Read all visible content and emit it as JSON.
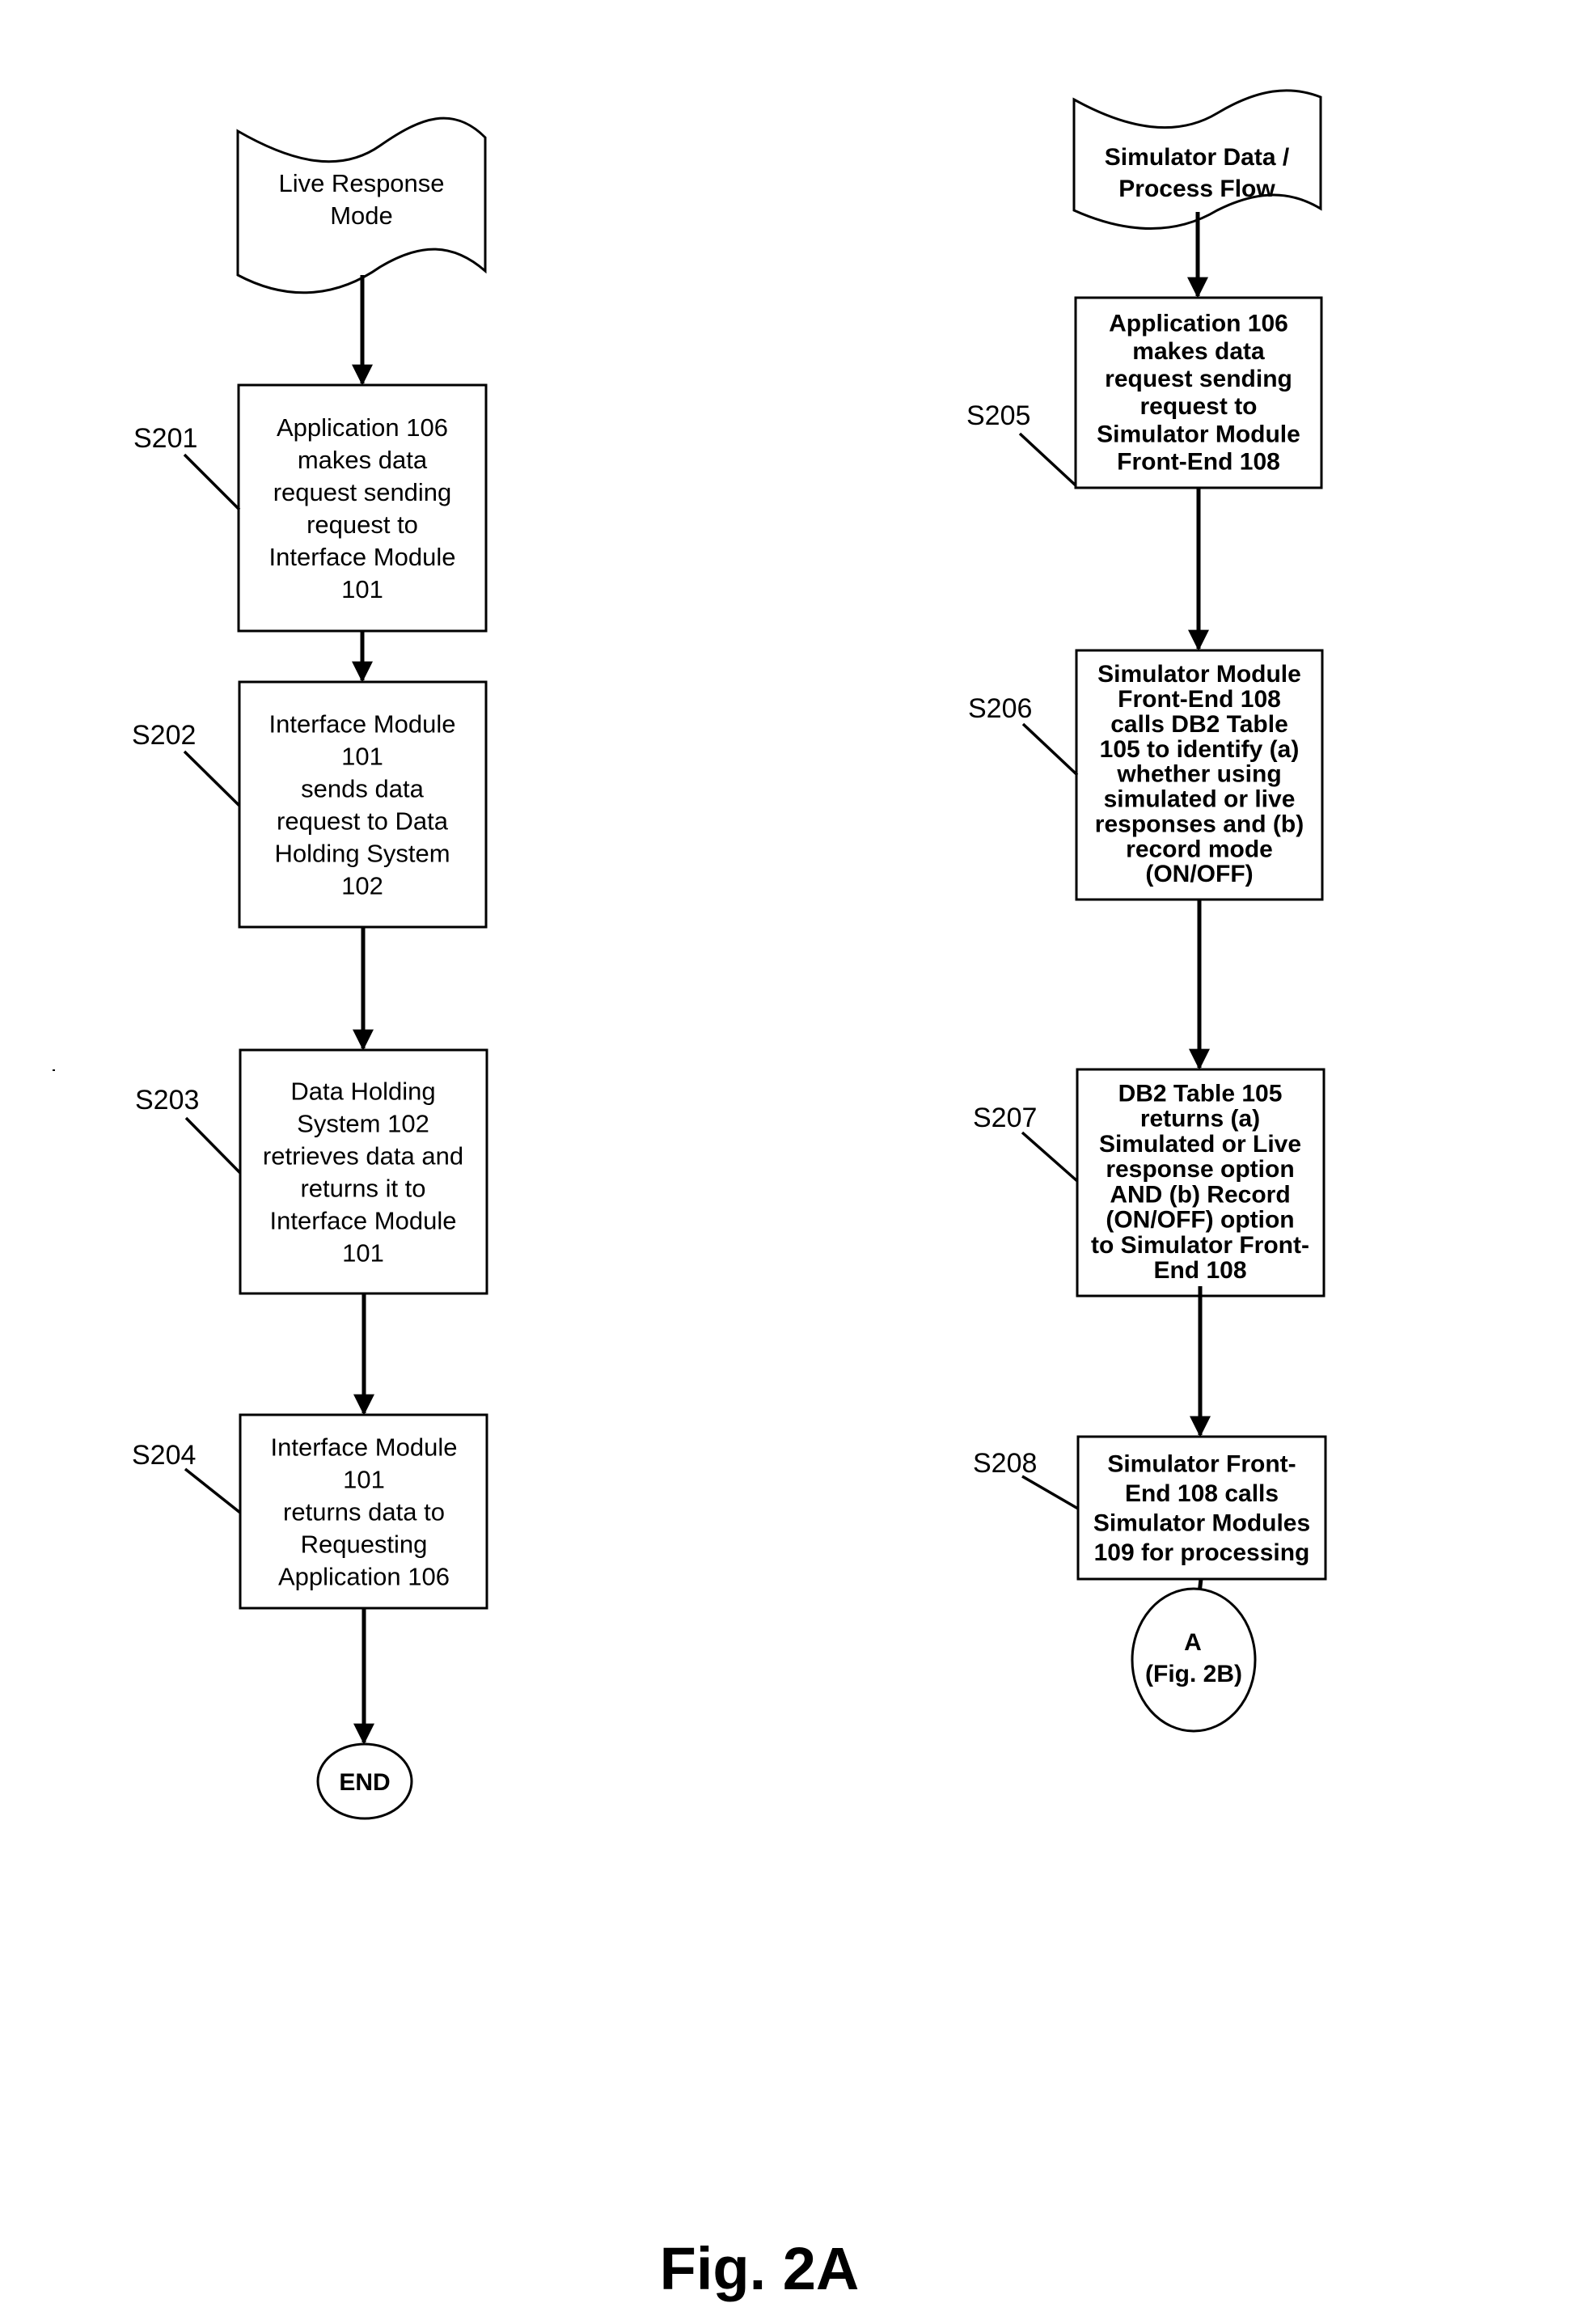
{
  "figure": {
    "caption": "Fig. 2A",
    "left_flow": {
      "start": {
        "lines": [
          "Live Response",
          "Mode"
        ],
        "shape": "document"
      },
      "steps": [
        {
          "id": "S201",
          "lines": [
            "Application 106",
            "makes data",
            "request sending",
            "request to",
            "Interface Module",
            "101"
          ]
        },
        {
          "id": "S202",
          "lines": [
            "Interface Module",
            "101",
            "sends data",
            "request to Data",
            "Holding System",
            "102"
          ]
        },
        {
          "id": "S203",
          "lines": [
            "Data Holding",
            "System 102",
            "retrieves data and",
            "returns it to",
            "Interface Module",
            "101"
          ]
        },
        {
          "id": "S204",
          "lines": [
            "Interface Module",
            "101",
            "returns data to",
            "Requesting",
            "Application 106"
          ]
        }
      ],
      "end": {
        "lines": [
          "END"
        ],
        "shape": "terminator"
      }
    },
    "right_flow": {
      "start": {
        "lines": [
          "Simulator Data /",
          "Process Flow"
        ],
        "shape": "document"
      },
      "steps": [
        {
          "id": "S205",
          "lines": [
            "Application 106",
            "makes data",
            "request sending",
            "request to",
            "Simulator Module",
            "Front-End 108"
          ]
        },
        {
          "id": "S206",
          "lines": [
            "Simulator Module",
            "Front-End 108",
            "calls DB2 Table",
            "105 to identify (a)",
            "whether using",
            "simulated or live",
            "responses and (b)",
            "record mode",
            "(ON/OFF)"
          ]
        },
        {
          "id": "S207",
          "lines": [
            "DB2 Table 105",
            "returns (a)",
            "Simulated or Live",
            "response option",
            "AND (b) Record",
            "(ON/OFF) option",
            "to Simulator Front-",
            "End 108"
          ]
        },
        {
          "id": "S208",
          "lines": [
            "Simulator Front-",
            "End 108 calls",
            "Simulator Modules",
            "109 for processing"
          ]
        }
      ],
      "end": {
        "lines": [
          "A",
          "(Fig. 2B)"
        ],
        "shape": "connector"
      }
    }
  }
}
